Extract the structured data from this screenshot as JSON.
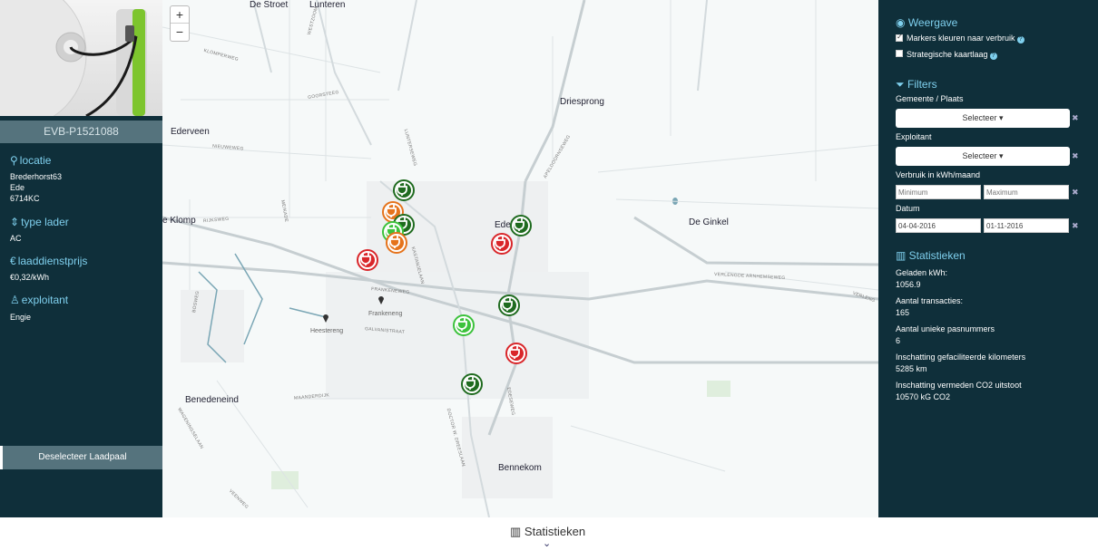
{
  "station": {
    "id": "EVB-P1521088",
    "location_heading": "locatie",
    "address": [
      "Brederhorst63",
      "Ede",
      "6714KC"
    ],
    "type_heading": "type lader",
    "type_value": "AC",
    "price_heading": "laaddienstprijs",
    "price_value": "€0,32/kWh",
    "operator_heading": "exploitant",
    "operator_value": "Engie",
    "deselect_label": "Deselecteer Laadpaal"
  },
  "map": {
    "zoom_in": "+",
    "zoom_out": "−",
    "places": [
      "De Stroet",
      "Lunteren",
      "Driesprong",
      "Ederveen",
      "De Ginkel",
      "e Klomp",
      "Ede",
      "Frankeneng",
      "Heestereng",
      "Benedeneind",
      "Bennekom"
    ],
    "streets": [
      "WESTZOOM",
      "KLOMPERWEG",
      "GOORSTEEG",
      "LUNTERSEWEG",
      "NIEUWEWEG",
      "RIJKSWEG",
      "MEIKADE",
      "APELDOORNSEWEG",
      "VERLENGDE ARNHEMSEWEG",
      "FRANKENEWEG",
      "GALVANISTRAAT",
      "MAANDERDIJK",
      "EDESEWEG",
      "DOCTOR W. DREESLAAN",
      "KASTANJELAAN",
      "WAGENINGSELAAN",
      "VEENWEG",
      "VERLENG",
      "BOSWEG"
    ],
    "markers": [
      {
        "status": "high",
        "color": "#1f6b1f"
      },
      {
        "status": "medium",
        "color": "#e5731b"
      },
      {
        "status": "high",
        "color": "#1f6b1f"
      },
      {
        "status": "low",
        "color": "#3cc23c"
      },
      {
        "status": "medium",
        "color": "#e5731b"
      },
      {
        "status": "very-high",
        "color": "#d9262a"
      },
      {
        "status": "high",
        "color": "#1f6b1f"
      },
      {
        "status": "very-high",
        "color": "#d9262a"
      },
      {
        "status": "high",
        "color": "#1f6b1f"
      },
      {
        "status": "low",
        "color": "#3cc23c"
      },
      {
        "status": "very-high",
        "color": "#d9262a"
      },
      {
        "status": "high",
        "color": "#1f6b1f"
      }
    ]
  },
  "panel": {
    "view_heading": "Weergave",
    "marker_color_label": "Markers kleuren naar verbruik",
    "marker_color_checked": true,
    "strategic_label": "Strategische kaartlaag",
    "strategic_checked": false,
    "filters_heading": "Filters",
    "municipality_label": "Gemeente / Plaats",
    "select_label": "Selecteer",
    "operator_label": "Exploitant",
    "usage_label": "Verbruik in kWh/maand",
    "min_placeholder": "Minimum",
    "max_placeholder": "Maximum",
    "date_label": "Datum",
    "date_from": "04-04-2016",
    "date_to": "01-11-2016",
    "stats_heading": "Statistieken",
    "stats": [
      {
        "label": "Geladen kWh:",
        "value": "1056.9"
      },
      {
        "label": "Aantal transacties:",
        "value": "165"
      },
      {
        "label": "Aantal unieke pasnummers",
        "value": "6"
      },
      {
        "label": "Inschatting gefaciliteerde kilometers",
        "value": "5285 km"
      },
      {
        "label": "Inschatting vermeden CO2 uitstoot",
        "value": "10570 kG CO2"
      }
    ]
  },
  "bottom": {
    "stats_button": "Statistieken"
  },
  "colors": {
    "panel_bg": "#0f2f3a",
    "accent": "#7fd0ee",
    "subtle": "#55737d"
  }
}
